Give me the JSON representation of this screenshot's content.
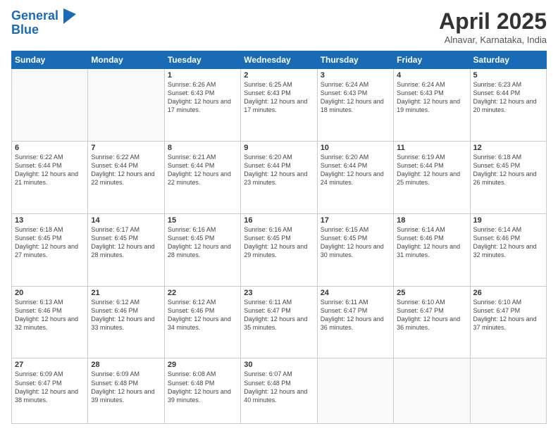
{
  "header": {
    "logo_line1": "General",
    "logo_line2": "Blue",
    "month": "April 2025",
    "location": "Alnavar, Karnataka, India"
  },
  "weekdays": [
    "Sunday",
    "Monday",
    "Tuesday",
    "Wednesday",
    "Thursday",
    "Friday",
    "Saturday"
  ],
  "weeks": [
    [
      {
        "day": "",
        "sunrise": "",
        "sunset": "",
        "daylight": ""
      },
      {
        "day": "",
        "sunrise": "",
        "sunset": "",
        "daylight": ""
      },
      {
        "day": "1",
        "sunrise": "Sunrise: 6:26 AM",
        "sunset": "Sunset: 6:43 PM",
        "daylight": "Daylight: 12 hours and 17 minutes."
      },
      {
        "day": "2",
        "sunrise": "Sunrise: 6:25 AM",
        "sunset": "Sunset: 6:43 PM",
        "daylight": "Daylight: 12 hours and 17 minutes."
      },
      {
        "day": "3",
        "sunrise": "Sunrise: 6:24 AM",
        "sunset": "Sunset: 6:43 PM",
        "daylight": "Daylight: 12 hours and 18 minutes."
      },
      {
        "day": "4",
        "sunrise": "Sunrise: 6:24 AM",
        "sunset": "Sunset: 6:43 PM",
        "daylight": "Daylight: 12 hours and 19 minutes."
      },
      {
        "day": "5",
        "sunrise": "Sunrise: 6:23 AM",
        "sunset": "Sunset: 6:44 PM",
        "daylight": "Daylight: 12 hours and 20 minutes."
      }
    ],
    [
      {
        "day": "6",
        "sunrise": "Sunrise: 6:22 AM",
        "sunset": "Sunset: 6:44 PM",
        "daylight": "Daylight: 12 hours and 21 minutes."
      },
      {
        "day": "7",
        "sunrise": "Sunrise: 6:22 AM",
        "sunset": "Sunset: 6:44 PM",
        "daylight": "Daylight: 12 hours and 22 minutes."
      },
      {
        "day": "8",
        "sunrise": "Sunrise: 6:21 AM",
        "sunset": "Sunset: 6:44 PM",
        "daylight": "Daylight: 12 hours and 22 minutes."
      },
      {
        "day": "9",
        "sunrise": "Sunrise: 6:20 AM",
        "sunset": "Sunset: 6:44 PM",
        "daylight": "Daylight: 12 hours and 23 minutes."
      },
      {
        "day": "10",
        "sunrise": "Sunrise: 6:20 AM",
        "sunset": "Sunset: 6:44 PM",
        "daylight": "Daylight: 12 hours and 24 minutes."
      },
      {
        "day": "11",
        "sunrise": "Sunrise: 6:19 AM",
        "sunset": "Sunset: 6:44 PM",
        "daylight": "Daylight: 12 hours and 25 minutes."
      },
      {
        "day": "12",
        "sunrise": "Sunrise: 6:18 AM",
        "sunset": "Sunset: 6:45 PM",
        "daylight": "Daylight: 12 hours and 26 minutes."
      }
    ],
    [
      {
        "day": "13",
        "sunrise": "Sunrise: 6:18 AM",
        "sunset": "Sunset: 6:45 PM",
        "daylight": "Daylight: 12 hours and 27 minutes."
      },
      {
        "day": "14",
        "sunrise": "Sunrise: 6:17 AM",
        "sunset": "Sunset: 6:45 PM",
        "daylight": "Daylight: 12 hours and 28 minutes."
      },
      {
        "day": "15",
        "sunrise": "Sunrise: 6:16 AM",
        "sunset": "Sunset: 6:45 PM",
        "daylight": "Daylight: 12 hours and 28 minutes."
      },
      {
        "day": "16",
        "sunrise": "Sunrise: 6:16 AM",
        "sunset": "Sunset: 6:45 PM",
        "daylight": "Daylight: 12 hours and 29 minutes."
      },
      {
        "day": "17",
        "sunrise": "Sunrise: 6:15 AM",
        "sunset": "Sunset: 6:45 PM",
        "daylight": "Daylight: 12 hours and 30 minutes."
      },
      {
        "day": "18",
        "sunrise": "Sunrise: 6:14 AM",
        "sunset": "Sunset: 6:46 PM",
        "daylight": "Daylight: 12 hours and 31 minutes."
      },
      {
        "day": "19",
        "sunrise": "Sunrise: 6:14 AM",
        "sunset": "Sunset: 6:46 PM",
        "daylight": "Daylight: 12 hours and 32 minutes."
      }
    ],
    [
      {
        "day": "20",
        "sunrise": "Sunrise: 6:13 AM",
        "sunset": "Sunset: 6:46 PM",
        "daylight": "Daylight: 12 hours and 32 minutes."
      },
      {
        "day": "21",
        "sunrise": "Sunrise: 6:12 AM",
        "sunset": "Sunset: 6:46 PM",
        "daylight": "Daylight: 12 hours and 33 minutes."
      },
      {
        "day": "22",
        "sunrise": "Sunrise: 6:12 AM",
        "sunset": "Sunset: 6:46 PM",
        "daylight": "Daylight: 12 hours and 34 minutes."
      },
      {
        "day": "23",
        "sunrise": "Sunrise: 6:11 AM",
        "sunset": "Sunset: 6:47 PM",
        "daylight": "Daylight: 12 hours and 35 minutes."
      },
      {
        "day": "24",
        "sunrise": "Sunrise: 6:11 AM",
        "sunset": "Sunset: 6:47 PM",
        "daylight": "Daylight: 12 hours and 36 minutes."
      },
      {
        "day": "25",
        "sunrise": "Sunrise: 6:10 AM",
        "sunset": "Sunset: 6:47 PM",
        "daylight": "Daylight: 12 hours and 36 minutes."
      },
      {
        "day": "26",
        "sunrise": "Sunrise: 6:10 AM",
        "sunset": "Sunset: 6:47 PM",
        "daylight": "Daylight: 12 hours and 37 minutes."
      }
    ],
    [
      {
        "day": "27",
        "sunrise": "Sunrise: 6:09 AM",
        "sunset": "Sunset: 6:47 PM",
        "daylight": "Daylight: 12 hours and 38 minutes."
      },
      {
        "day": "28",
        "sunrise": "Sunrise: 6:09 AM",
        "sunset": "Sunset: 6:48 PM",
        "daylight": "Daylight: 12 hours and 39 minutes."
      },
      {
        "day": "29",
        "sunrise": "Sunrise: 6:08 AM",
        "sunset": "Sunset: 6:48 PM",
        "daylight": "Daylight: 12 hours and 39 minutes."
      },
      {
        "day": "30",
        "sunrise": "Sunrise: 6:07 AM",
        "sunset": "Sunset: 6:48 PM",
        "daylight": "Daylight: 12 hours and 40 minutes."
      },
      {
        "day": "",
        "sunrise": "",
        "sunset": "",
        "daylight": ""
      },
      {
        "day": "",
        "sunrise": "",
        "sunset": "",
        "daylight": ""
      },
      {
        "day": "",
        "sunrise": "",
        "sunset": "",
        "daylight": ""
      }
    ]
  ]
}
